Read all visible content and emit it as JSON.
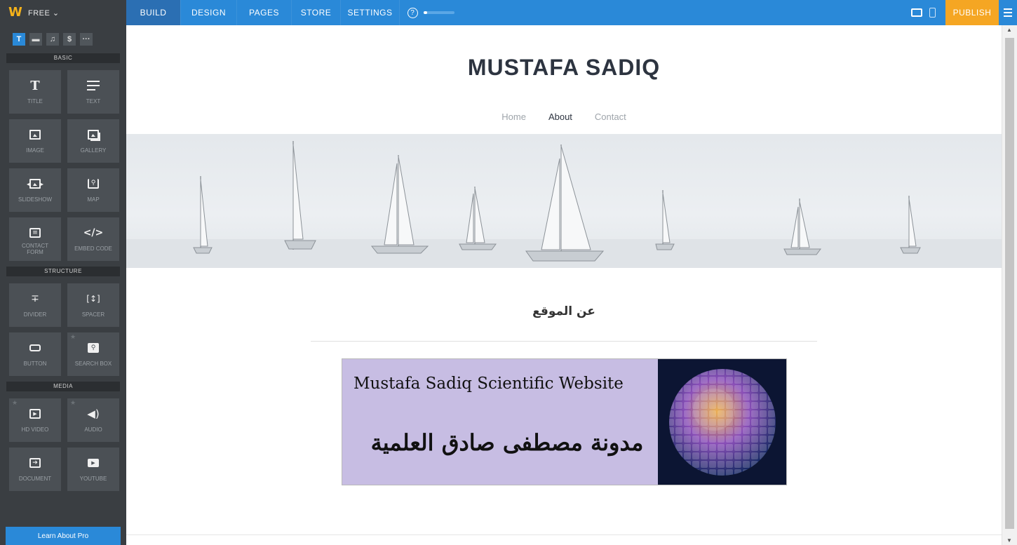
{
  "app": {
    "plan_label": "FREE ⌄",
    "logo_glyph": "W",
    "nav_tabs": [
      "BUILD",
      "DESIGN",
      "PAGES",
      "STORE",
      "SETTINGS"
    ],
    "help_glyph": "?",
    "progress_fraction": 0.12,
    "publish_label": "PUBLISH",
    "accent_color": "#2a89d8",
    "publish_color": "#f5a623"
  },
  "sidebar": {
    "tools": [
      "T",
      "▬",
      "♫",
      "$",
      "···"
    ],
    "sections": {
      "basic": "BASIC",
      "structure": "STRUCTURE",
      "media": "MEDIA"
    },
    "basic_items": [
      {
        "label": "TITLE",
        "icon": "title-icon"
      },
      {
        "label": "TEXT",
        "icon": "text-icon"
      },
      {
        "label": "IMAGE",
        "icon": "image-icon"
      },
      {
        "label": "GALLERY",
        "icon": "gallery-icon"
      },
      {
        "label": "SLIDESHOW",
        "icon": "slideshow-icon"
      },
      {
        "label": "MAP",
        "icon": "map-icon"
      },
      {
        "label": "CONTACT FORM",
        "icon": "contact-form-icon"
      },
      {
        "label": "EMBED CODE",
        "icon": "embed-code-icon"
      }
    ],
    "structure_items": [
      {
        "label": "DIVIDER",
        "icon": "divider-icon"
      },
      {
        "label": "SPACER",
        "icon": "spacer-icon"
      },
      {
        "label": "BUTTON",
        "icon": "button-icon"
      },
      {
        "label": "SEARCH BOX",
        "icon": "search-box-icon"
      }
    ],
    "media_items": [
      {
        "label": "HD VIDEO",
        "icon": "hd-video-icon"
      },
      {
        "label": "AUDIO",
        "icon": "audio-icon"
      },
      {
        "label": "DOCUMENT",
        "icon": "document-icon"
      },
      {
        "label": "YOUTUBE",
        "icon": "youtube-icon"
      }
    ],
    "learn_label": "Learn About Pro"
  },
  "site": {
    "title": "MUSTAFA SADIQ",
    "nav": [
      "Home",
      "About",
      "Contact"
    ],
    "active_nav": "About",
    "section_heading": "عن الموقع",
    "logo_text_en": "Mustafa Sadiq Scientific Website",
    "logo_text_ar": "مدونة مصطفى صادق العلمية"
  }
}
